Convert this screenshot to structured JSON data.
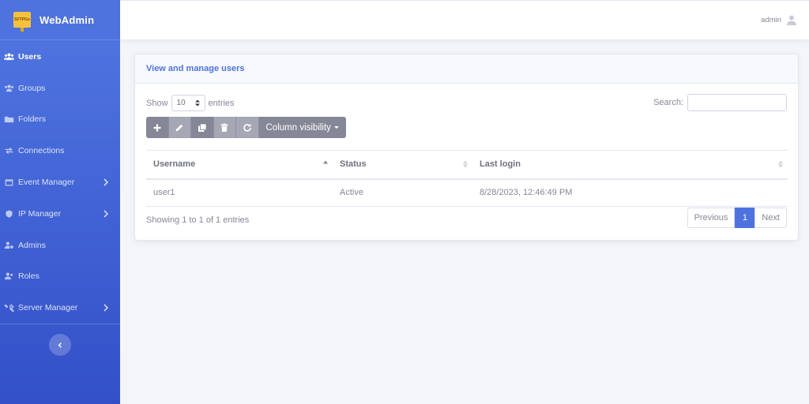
{
  "brand": {
    "name": "WebAdmin",
    "logo_text": "SFTPGo"
  },
  "sidebar": {
    "items": [
      {
        "label": "Users",
        "icon": "users-icon",
        "active": true
      },
      {
        "label": "Groups",
        "icon": "users-icon"
      },
      {
        "label": "Folders",
        "icon": "folder-icon"
      },
      {
        "label": "Connections",
        "icon": "exchange-icon"
      },
      {
        "label": "Event Manager",
        "icon": "calendar-icon",
        "has_submenu": true
      },
      {
        "label": "IP Manager",
        "icon": "shield-icon",
        "has_submenu": true
      },
      {
        "label": "Admins",
        "icon": "user-cog-icon"
      },
      {
        "label": "Roles",
        "icon": "users-icon"
      },
      {
        "label": "Server Manager",
        "icon": "tools-icon",
        "has_submenu": true
      }
    ],
    "toggle_icon": "chevron-left-icon"
  },
  "topbar": {
    "username": "admin",
    "avatar_icon": "user-icon"
  },
  "card": {
    "title": "View and manage users",
    "length": {
      "show_label": "Show",
      "value": "10",
      "entries_label": "entries"
    },
    "search_label": "Search:",
    "toolbar": {
      "buttons": [
        "plus-icon",
        "pencil-icon",
        "clone-icon",
        "trash-icon",
        "refresh-icon"
      ],
      "column_visibility": "Column visibility"
    },
    "table": {
      "columns": [
        "Username",
        "Status",
        "Last login"
      ],
      "rows": [
        [
          "user1",
          "Active",
          "8/28/2023, 12:46:49 PM"
        ]
      ]
    },
    "info": "Showing 1 to 1 of 1 entries",
    "pagination": {
      "previous": "Previous",
      "current": "1",
      "next": "Next"
    }
  },
  "colors": {
    "primary": "#4e73df",
    "sidebar_bottom": "#3350c8",
    "button_gray": "#858796"
  }
}
